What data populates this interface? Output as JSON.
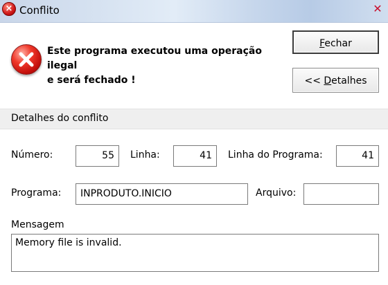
{
  "window": {
    "title": "Conflito",
    "close_glyph": "✕",
    "app_icon": "error-icon",
    "app_icon_glyph": "×"
  },
  "message": {
    "line1": "Este programa executou uma operação ilegal",
    "line2": "e será fechado !"
  },
  "buttons": {
    "fechar_pre": "",
    "fechar_mnemonic": "F",
    "fechar_post": "echar",
    "detalhes_pre": "<< ",
    "detalhes_mnemonic": "D",
    "detalhes_post": "etalhes"
  },
  "details": {
    "header": "Detalhes do conflito",
    "numero_label": "Número:",
    "numero_value": "55",
    "linha_label": "Linha:",
    "linha_value": "41",
    "linha_programa_label": "Linha do Programa:",
    "linha_programa_value": "41",
    "programa_label": "Programa:",
    "programa_value": "INPRODUTO.INICIO",
    "arquivo_label": "Arquivo:",
    "arquivo_value": "",
    "mensagem_label": "Mensagem",
    "mensagem_value": "Memory file is invalid."
  },
  "colors": {
    "error_red": "#d01818",
    "section_bg": "#efefef"
  }
}
